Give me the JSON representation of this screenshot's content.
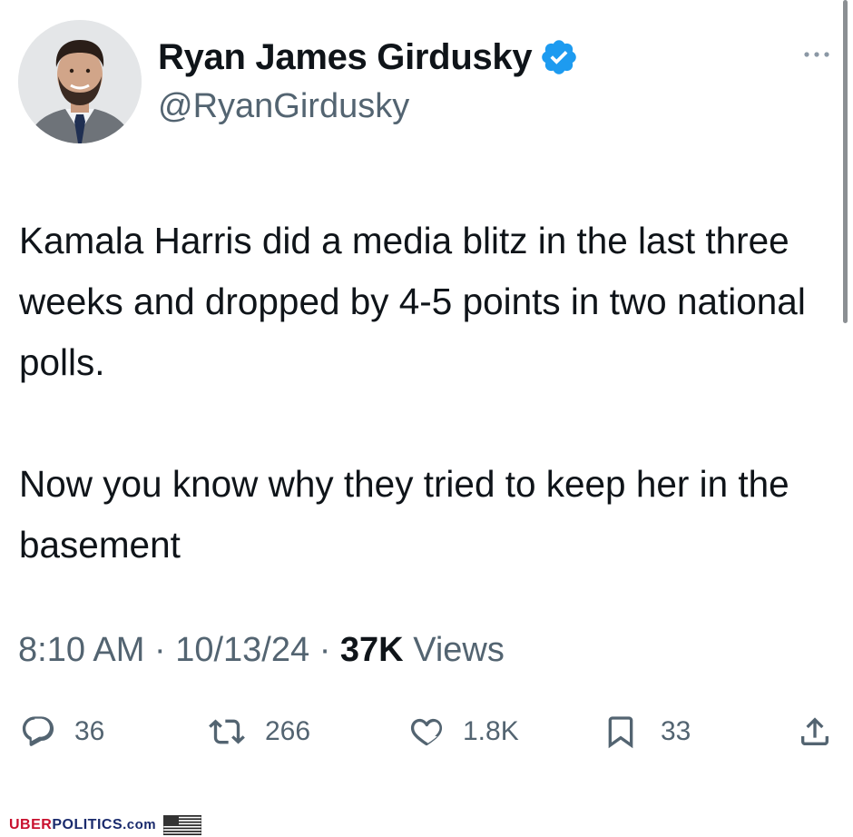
{
  "author": {
    "display_name": "Ryan James Girdusky",
    "handle": "@RyanGirdusky",
    "verified": true,
    "verified_color": "#1d9bf0"
  },
  "tweet": {
    "paragraphs": [
      "Kamala Harris did a media blitz in the last three weeks and dropped by 4-5 points in two national polls.",
      "Now you know why they tried to keep her in the basement"
    ]
  },
  "meta": {
    "time": "8:10 AM",
    "separator": "·",
    "date": "10/13/24",
    "views_count": "37K",
    "views_label": "Views"
  },
  "actions": {
    "replies": "36",
    "reposts": "266",
    "likes": "1.8K",
    "bookmarks": "33"
  },
  "icons": {
    "more": "more-icon",
    "reply": "reply-icon",
    "repost": "repost-icon",
    "like": "heart-icon",
    "bookmark": "bookmark-icon",
    "share": "share-icon"
  },
  "colors": {
    "text_primary": "#0f1419",
    "text_secondary": "#536471",
    "accent": "#1d9bf0"
  },
  "watermark": {
    "part1": "UBER",
    "part2": "POLITICS",
    "part3": ".com"
  }
}
